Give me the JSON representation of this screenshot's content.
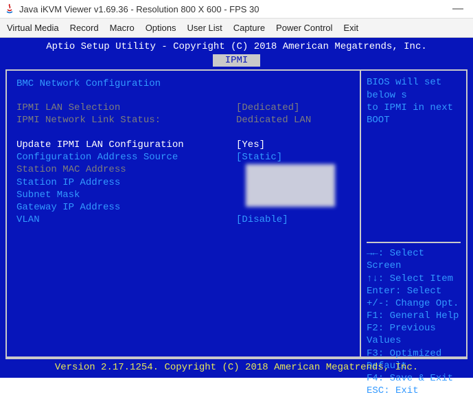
{
  "window": {
    "title": "Java iKVM Viewer v1.69.36              - Resolution 800 X 600 - FPS 30"
  },
  "menubar": {
    "items": [
      "Virtual Media",
      "Record",
      "Macro",
      "Options",
      "User List",
      "Capture",
      "Power Control",
      "Exit"
    ]
  },
  "bios": {
    "header": "Aptio Setup Utility - Copyright (C) 2018 American Megatrends, Inc.",
    "tab": "IPMI",
    "section_title": "BMC Network Configuration",
    "fields": {
      "ipmi_lan_selection": {
        "label": "IPMI LAN Selection",
        "value": "[Dedicated]"
      },
      "ipmi_link_status": {
        "label": "IPMI Network Link Status:",
        "value": "Dedicated LAN"
      },
      "update_ipmi": {
        "label": "Update IPMI LAN Configuration",
        "value": "[Yes]"
      },
      "config_source": {
        "label": "Configuration Address Source",
        "value": "[Static]"
      },
      "station_mac": {
        "label": "Station MAC Address",
        "value": ""
      },
      "station_ip": {
        "label": "Station IP Address",
        "value": ""
      },
      "subnet_mask": {
        "label": "Subnet Mask",
        "value": ""
      },
      "gateway_ip": {
        "label": "Gateway IP Address",
        "value": ""
      },
      "vlan": {
        "label": "VLAN",
        "value": "[Disable]"
      }
    },
    "help": {
      "line1": "BIOS will set below s",
      "line2": "to IPMI in next BOOT"
    },
    "keys": {
      "k1": "→←: Select Screen",
      "k2": "↑↓: Select Item",
      "k3": "Enter: Select",
      "k4": "+/-: Change Opt.",
      "k5": "F1: General Help",
      "k6": "F2: Previous Values",
      "k7": "F3: Optimized Default",
      "k8": "F4: Save & Exit",
      "k9": "ESC: Exit"
    },
    "footer": "Version 2.17.1254. Copyright (C) 2018 American Megatrends, Inc."
  }
}
